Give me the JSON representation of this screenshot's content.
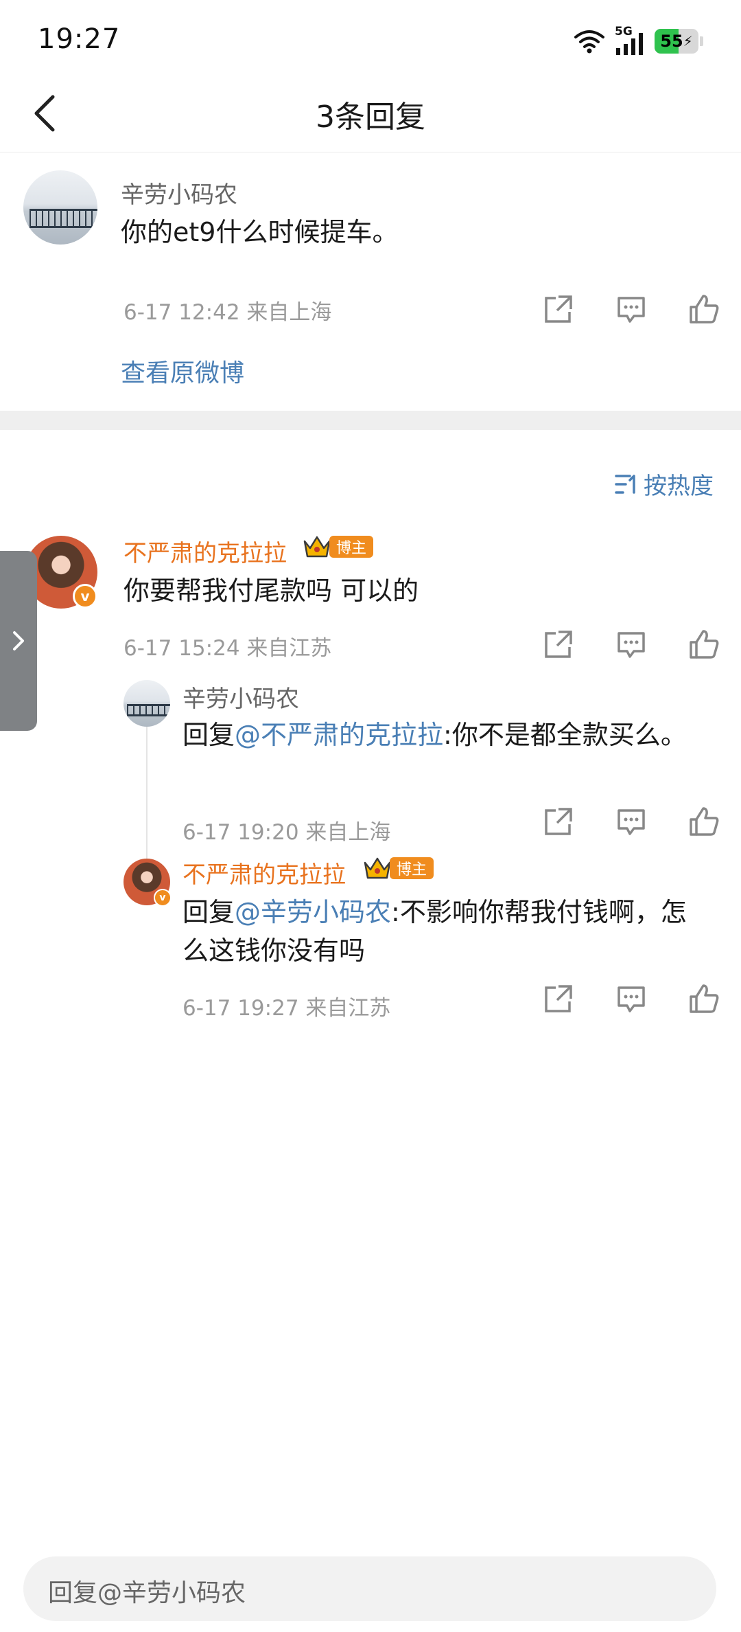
{
  "status_bar": {
    "time": "19:27",
    "network": "5G",
    "battery": "55",
    "battery_color": "#2fc24e"
  },
  "nav": {
    "title": "3条回复",
    "icons": [
      "back-arrow-icon"
    ]
  },
  "root_comment": {
    "user": "辛劳小码农",
    "text": "你的et9什么时候提车。",
    "meta": "6-17 12:42  来自上海",
    "view_original": "查看原微博"
  },
  "sort": {
    "label": "按热度"
  },
  "main_reply": {
    "user": "不严肃的克拉拉",
    "badge": "博主",
    "text": "你要帮我付尾款吗 可以的",
    "meta": "6-17 15:24  来自江苏"
  },
  "sub_replies": [
    {
      "user": "辛劳小码农",
      "prefix": "回复",
      "mention": "@不严肃的克拉拉",
      "text": ":你不是都全款买么。",
      "meta": "6-17 19:20  来自上海"
    },
    {
      "user": "不严肃的克拉拉",
      "badge": "博主",
      "prefix": "回复",
      "mention": "@辛劳小码农",
      "text": ":不影响你帮我付钱啊，怎么这钱你没有吗",
      "meta": "6-17 19:27  来自江苏"
    }
  ],
  "reply_bar": {
    "placeholder": "回复@辛劳小码农"
  },
  "colors": {
    "accent_blue": "#4a7fb5",
    "username_orange": "#e8731f",
    "badge_orange": "#f08c1e"
  }
}
